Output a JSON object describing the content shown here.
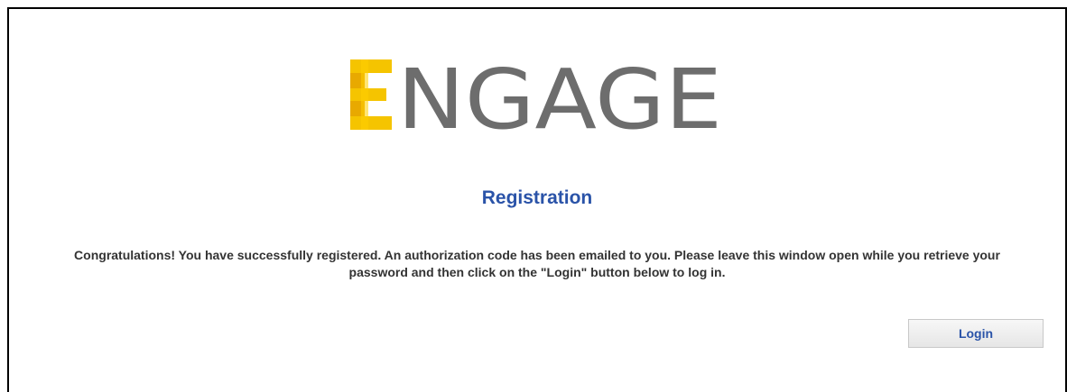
{
  "logo": {
    "first_letter": "E",
    "rest_text": "NGAGE",
    "accent_color": "#f0bc00",
    "text_color": "#6d6d6d"
  },
  "page": {
    "title": "Registration",
    "message": "Congratulations! You have successfully registered. An authorization code has been emailed to you. Please leave this window open while you retrieve your password and then click on the \"Login\" button below to log in."
  },
  "actions": {
    "login_label": "Login"
  },
  "colors": {
    "title": "#2a53a8",
    "message": "#333333",
    "button_text": "#2a53a8"
  }
}
